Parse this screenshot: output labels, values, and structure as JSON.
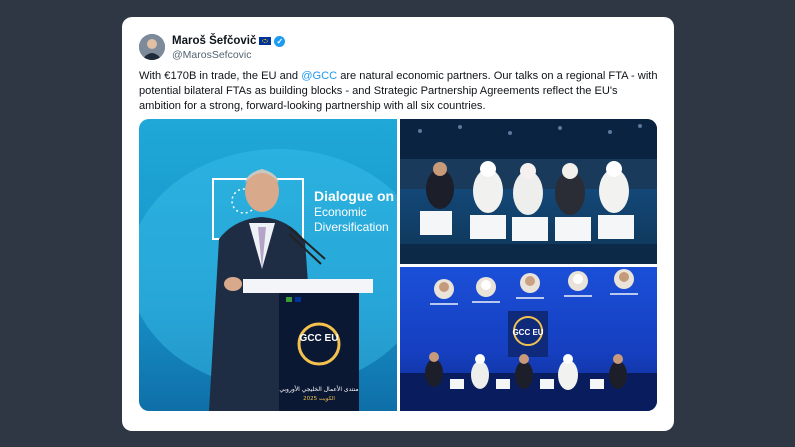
{
  "tweet": {
    "author_name": "Maroš Šefčovič",
    "handle": "@MarosSefcovic",
    "text_before": "With €170B in trade, the EU and ",
    "mention": "@GCC",
    "text_after": " are natural economic partners. Our talks on a regional FTA - with potential bilateral FTAs as building blocks - and Strategic Partnership Agreements reflect the EU's ambition for a strong, forward-looking partnership with all six countries."
  },
  "media": {
    "photo1": {
      "sign_title": "Dialogue on",
      "sign_line2": "Economic",
      "sign_line3": "Diversification",
      "podium_logo": "GCC EU",
      "podium_arabic": "منتدى الأعمال الخليجي الأوروبي",
      "podium_sub": "الكويت 2025"
    },
    "photo3": {
      "screen_logo": "GCC EU"
    }
  },
  "colors": {
    "page_bg": "#2f3744",
    "card_bg": "#ffffff",
    "link": "#1d9bf0",
    "verified": "#1d9bf0"
  }
}
